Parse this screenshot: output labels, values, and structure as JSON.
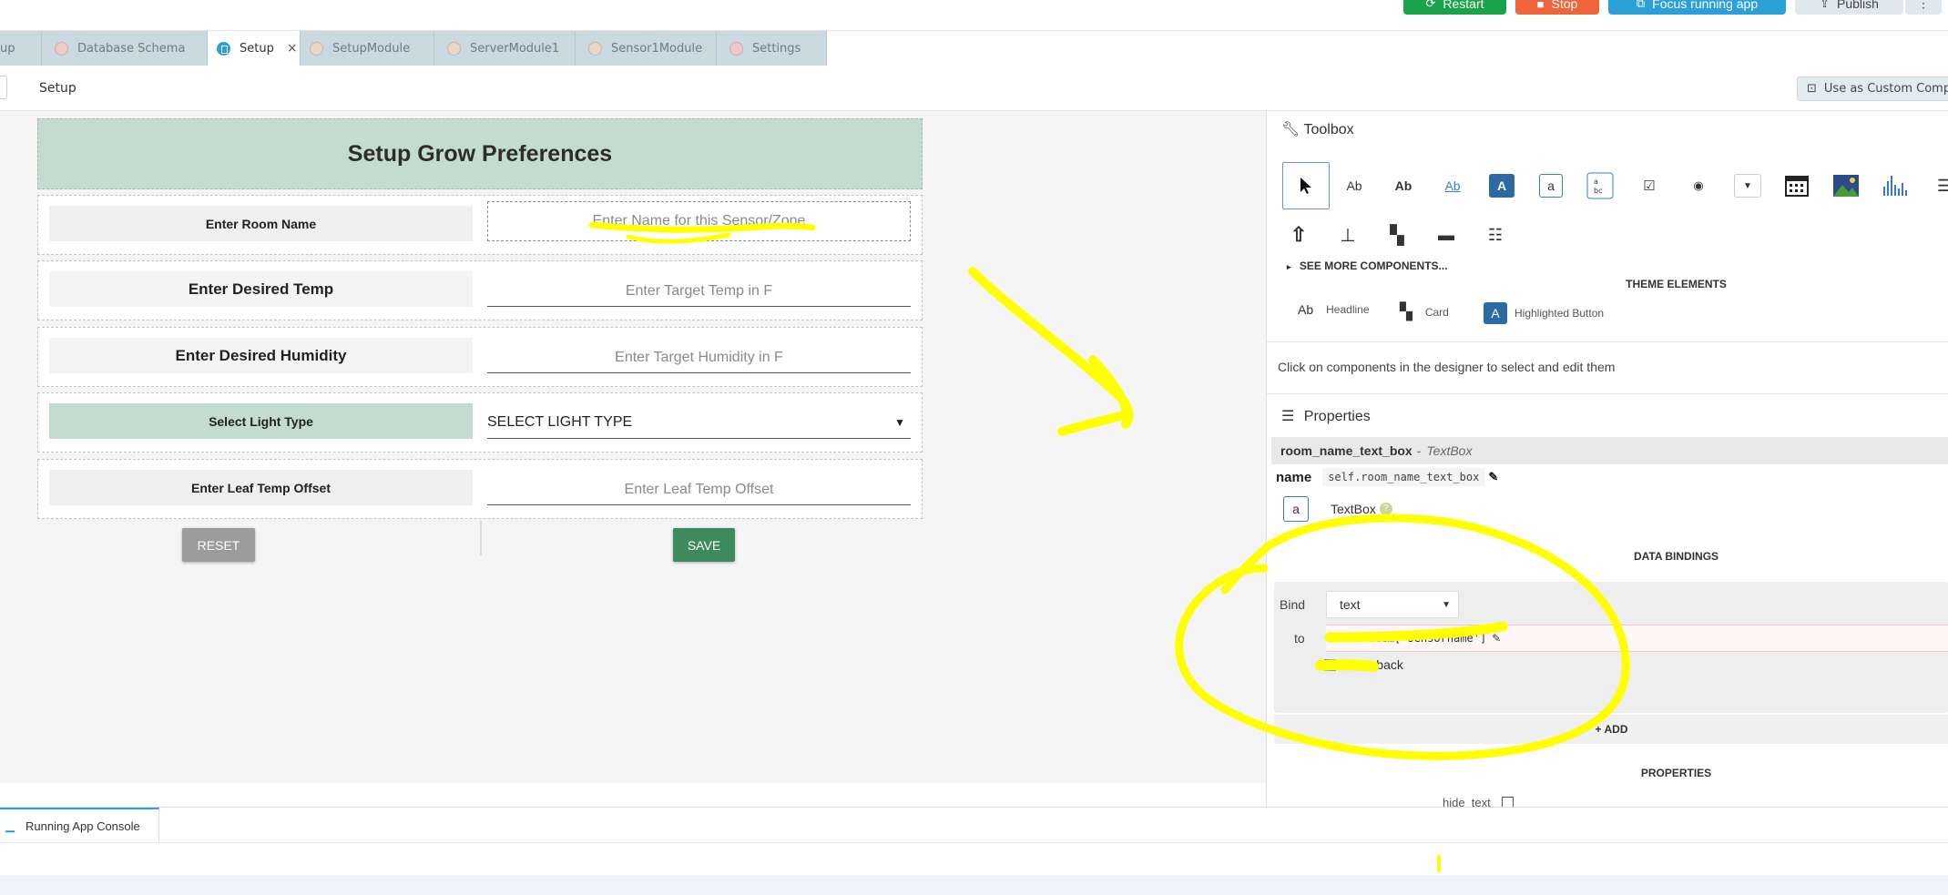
{
  "topbar": {
    "restart_label": "Restart",
    "stop_label": "Stop",
    "focus_label": "Focus running app",
    "publish_label": "Publish"
  },
  "tabs": [
    {
      "label": "up"
    },
    {
      "label": "Database Schema"
    },
    {
      "label": "Setup"
    },
    {
      "label": "SetupModule"
    },
    {
      "label": "ServerModule1"
    },
    {
      "label": "Sensor1Module"
    },
    {
      "label": "Settings"
    }
  ],
  "breadcrumb": {
    "title": "Setup",
    "custom_component_label": "Use as Custom Component"
  },
  "form": {
    "header": "Setup Grow Preferences",
    "rows": [
      {
        "label": "Enter Room Name",
        "placeholder": "Enter Name for this Sensor/Zone"
      },
      {
        "label": "Enter Desired Temp",
        "placeholder": "Enter Target Temp in F"
      },
      {
        "label": "Enter Desired Humidity",
        "placeholder": "Enter Target Humidity in F"
      },
      {
        "label": "Select Light Type",
        "value": "SELECT LIGHT TYPE"
      },
      {
        "label": "Enter Leaf Temp Offset",
        "placeholder": "Enter Leaf Temp Offset"
      }
    ],
    "reset_label": "RESET",
    "save_label": "SAVE"
  },
  "toolbox": {
    "title": "Toolbox",
    "tools": {
      "label_ab": "Ab",
      "bold_ab": "Ab",
      "link_ab": "Ab",
      "button_a": "A",
      "textbox_a": "a"
    },
    "see_more": "SEE MORE COMPONENTS...",
    "theme_title": "THEME ELEMENTS",
    "theme_items": [
      {
        "icon": "Ab",
        "label": "Headline"
      },
      {
        "label": "Card"
      },
      {
        "icon": "A",
        "label": "Highlighted Button"
      }
    ],
    "hint": "Click on components in the designer to select and edit them"
  },
  "properties": {
    "title": "Properties",
    "component_name": "room_name_text_box",
    "component_type": "TextBox",
    "name_label": "name",
    "name_value": "self.room_name_text_box",
    "type_icon": "a",
    "type_label": "TextBox",
    "help_mark": "?",
    "data_bindings_title": "DATA BINDINGS",
    "bind_label": "Bind",
    "bind_value": "text",
    "to_label": "to",
    "to_value": "self.item['sensorname']",
    "write_back_label": "Write back",
    "write_back_checked": true,
    "add_label": "ADD",
    "properties_title": "PROPERTIES",
    "hide_text_label": "hide_text"
  },
  "console": {
    "tab_label": "Running App Console"
  },
  "colors": {
    "restart": "#1aa34a",
    "stop": "#f0643c",
    "focus": "#2ba0d8",
    "publish": "#dfe8ec",
    "highlight": "#ffff00",
    "header_green": "#c3dccf",
    "save_green": "#3e8a5c"
  }
}
